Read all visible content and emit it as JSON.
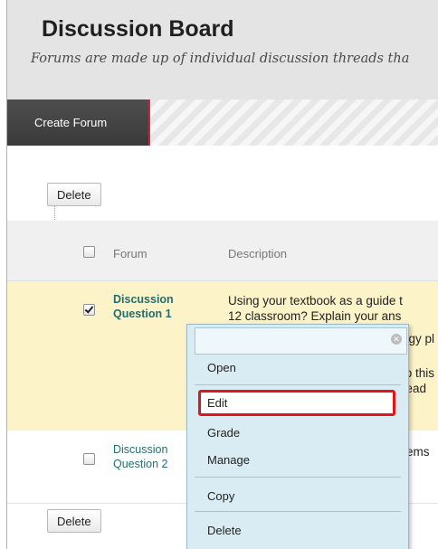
{
  "header": {
    "title": "Discussion Board",
    "subtitle": "Forums are made up of individual discussion threads tha"
  },
  "action_bar": {
    "create_forum_label": "Create Forum"
  },
  "buttons": {
    "delete_top": "Delete",
    "delete_bottom": "Delete"
  },
  "table": {
    "columns": {
      "forum": "Forum",
      "description": "Description"
    },
    "rows": [
      {
        "forum_line1": "Discussion",
        "forum_line2": "Question 1",
        "checked": true,
        "description_lines": [
          "Using your textbook as a guide t",
          "12 classroom? Explain your ans",
          "ogy pl",
          "to this",
          "read"
        ]
      },
      {
        "forum_line1": "Discussion",
        "forum_line2": "Question 2",
        "checked": false,
        "description_lines": [
          "lems"
        ]
      }
    ]
  },
  "context_menu": {
    "items": [
      "Open",
      "Edit",
      "Grade",
      "Manage",
      "Copy",
      "Delete"
    ],
    "highlighted": "Edit"
  },
  "colors": {
    "highlight_box": "#e1151b",
    "selected_row": "#fdf3c8",
    "menu_bg": "#d9ecf3",
    "forum_link": "#256e6e"
  }
}
